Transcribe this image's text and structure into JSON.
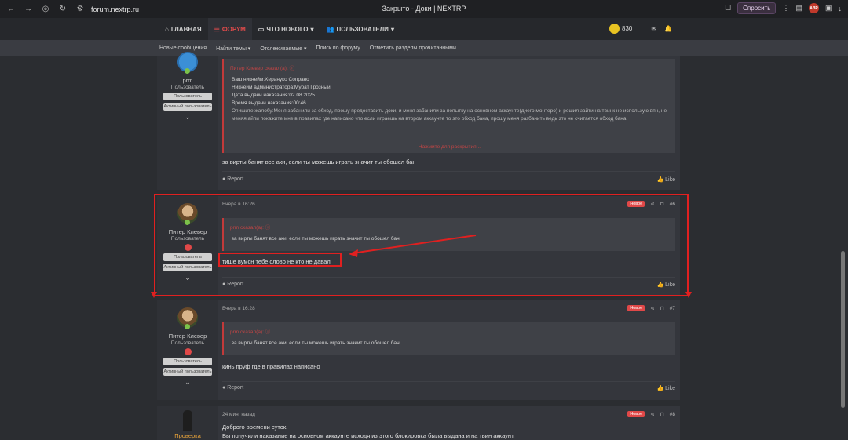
{
  "browser": {
    "url": "forum.nextrp.ru",
    "tab_title": "Закрыто - Доки | NEXTRP",
    "ask_label": "Спросить",
    "abp_label": "ABP"
  },
  "nav": {
    "items": [
      {
        "label": "ГЛАВНАЯ",
        "icon": "home-icon"
      },
      {
        "label": "ФОРУМ",
        "icon": "forum-icon",
        "active": true
      },
      {
        "label": "ЧТО НОВОГО",
        "icon": "chat-icon"
      },
      {
        "label": "ПОЛЬЗОВАТЕЛИ",
        "icon": "users-icon"
      }
    ],
    "coins": "830"
  },
  "subnav": [
    "Новые сообщения",
    "Найти темы",
    "Отслеживаемые",
    "Поиск по форуму",
    "Отметить разделы прочитанными"
  ],
  "post1": {
    "username": "prm",
    "user_title": "Пользователь",
    "badge1": "Пользователь",
    "badge2": "Активный пользователь",
    "quote_head": "Питер Клевер сказал(а): ⓘ",
    "quote_lines": [
      "Ваш никнейм:Херануко Сопрано",
      "Никнейм администратора:Мурат Грозный",
      "Дата выдачи наказания:02.08.2025",
      "Время выдачи наказания:00:46",
      "Опишите жалобу:Меня забанили за обход, прошу предоставить доки, и меня забанили за попытку на основном аккаунте(диего монтеро) и решил зайти на твинк не использую впн, не меняя айпи покажите мне в правилах где написано что если играешь на втором аккаунте то это обход бана, прошу меня разбанить ведь это не считается обход бана."
    ],
    "quote_more": "Нажмите для раскрытия...",
    "message": "за вирты банят все аки, если ты можешь играть значит ты обошел бан",
    "report": "Report",
    "like": "Like"
  },
  "post2": {
    "username": "Питер Клевер",
    "user_title": "Пользователь",
    "badge1": "Пользователь",
    "badge2": "Активный пользователь",
    "time": "Вчера в 16:26",
    "new_badge": "Новое",
    "num": "#6",
    "quote_head": "prm сказал(а): ⓘ",
    "quote_text": "за вирты банят все аки, если ты можешь играть значит ты обошел бан",
    "message": "тише вумсн тебе слово не кто не давал",
    "report": "Report",
    "like": "Like"
  },
  "post3": {
    "username": "Питер Клевер",
    "user_title": "Пользователь",
    "badge1": "Пользователь",
    "badge2": "Активный пользователь",
    "time": "Вчера в 16:28",
    "new_badge": "Новое",
    "num": "#7",
    "quote_head": "prm сказал(а): ⓘ",
    "quote_text": "за вирты банят все аки, если ты можешь играть значит ты обошел бан",
    "message": "кинь пруф где в правилах написано",
    "report": "Report",
    "like": "Like"
  },
  "post4": {
    "time": "24 мин. назад",
    "new_badge": "Новое",
    "num": "#8",
    "username": "Проверка",
    "line1": "Доброго времени суток.",
    "line2": "Вы получили наказание на основном аккаунте исходя из этого блокировка была выдана и на твин аккаунт."
  },
  "colors": {
    "accent": "#e14b4b",
    "annotation": "#e02020"
  }
}
